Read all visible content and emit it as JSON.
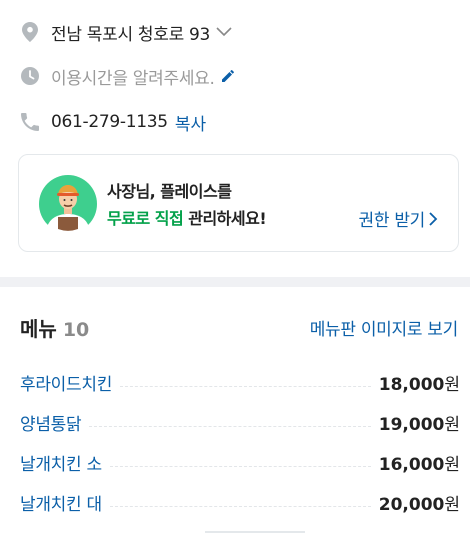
{
  "info": {
    "address": "전남 목포시 청호로 93",
    "hours_placeholder": "이용시간을 알려주세요.",
    "phone": "061-279-1135",
    "copy_label": "복사"
  },
  "owner_card": {
    "line1": "사장님, 플레이스를",
    "line2_highlight": "무료로 직접",
    "line2_rest": " 관리하세요!",
    "claim_label": "권한 받기"
  },
  "menu": {
    "title": "메뉴",
    "count": "10",
    "board_link": "메뉴판 이미지로 보기",
    "currency": "원",
    "items": [
      {
        "name": "후라이드치킨",
        "price": "18,000"
      },
      {
        "name": "양념통닭",
        "price": "19,000"
      },
      {
        "name": "날개치킨 소",
        "price": "16,000"
      },
      {
        "name": "날개치킨 대",
        "price": "20,000"
      }
    ]
  },
  "colors": {
    "link": "#0b5fa8",
    "accent_green": "#03a14a",
    "muted": "#9a9a9a",
    "icon_gray": "#b4b9bd"
  },
  "icons": [
    "location-pin-icon",
    "chevron-down-icon",
    "clock-icon",
    "pencil-icon",
    "phone-icon",
    "chevron-right-icon"
  ]
}
